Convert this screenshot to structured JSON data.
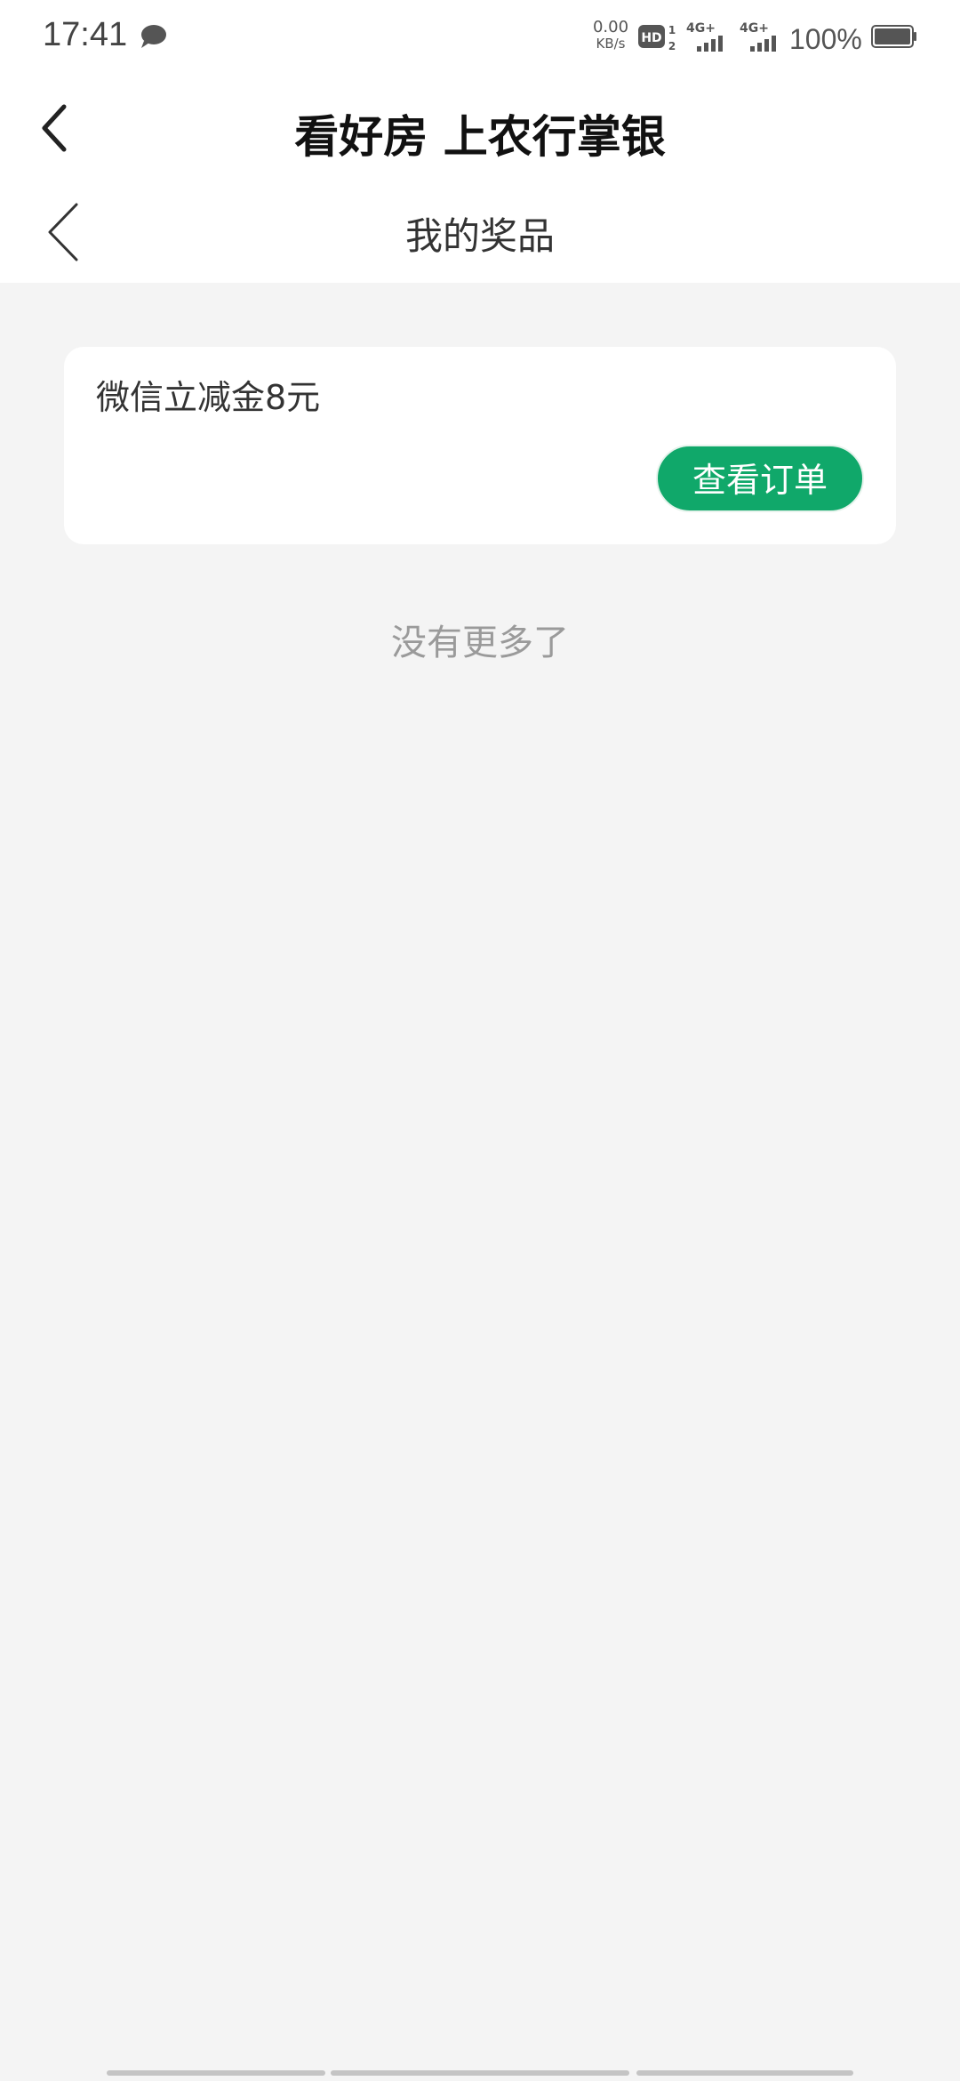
{
  "status_bar": {
    "time": "17:41",
    "net_speed_value": "0.00",
    "net_speed_unit": "KB/s",
    "battery_percent": "100%",
    "icons": [
      "chat-bubble-icon",
      "hd-icon",
      "signal-4g-icon",
      "signal-4g-icon",
      "battery-icon"
    ]
  },
  "header": {
    "title": "看好房 上农行掌银"
  },
  "sub_header": {
    "title": "我的奖品"
  },
  "prizes": [
    {
      "name": "微信立减金8元",
      "action_label": "查看订单"
    }
  ],
  "list_end_text": "没有更多了",
  "colors": {
    "accent": "#10a86a",
    "background": "#f4f4f4",
    "card": "#ffffff"
  }
}
